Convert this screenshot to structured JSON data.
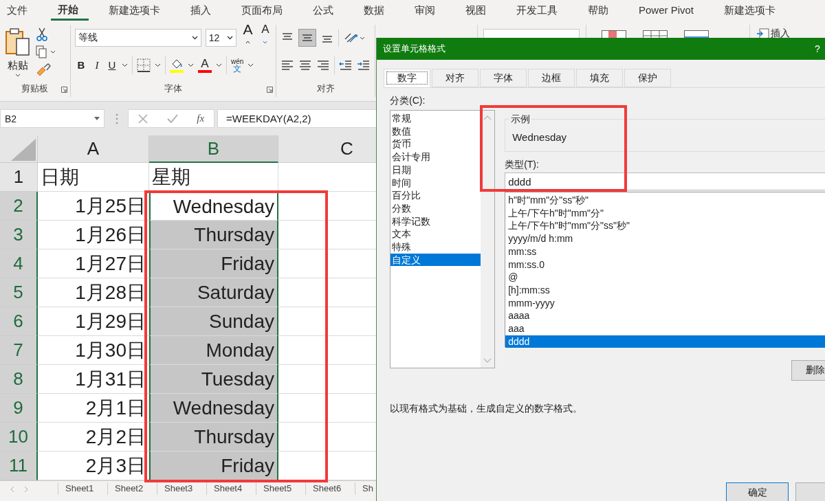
{
  "menu_tabs": [
    {
      "label": "文件",
      "selected": false
    },
    {
      "label": "开始",
      "selected": true
    },
    {
      "label": "新建选项卡",
      "selected": false
    },
    {
      "label": "插入",
      "selected": false
    },
    {
      "label": "页面布局",
      "selected": false
    },
    {
      "label": "公式",
      "selected": false
    },
    {
      "label": "数据",
      "selected": false
    },
    {
      "label": "审阅",
      "selected": false
    },
    {
      "label": "视图",
      "selected": false
    },
    {
      "label": "开发工具",
      "selected": false
    },
    {
      "label": "帮助",
      "selected": false
    },
    {
      "label": "Power Pivot",
      "selected": false
    },
    {
      "label": "新建选项卡",
      "selected": false
    }
  ],
  "ribbon": {
    "paste_label": "粘贴",
    "clipboard_group": "剪贴板",
    "font_name": "等线",
    "font_size": "12",
    "grow_font": "A",
    "shrink_font": "A",
    "bold": "B",
    "italic": "I",
    "underline": "U",
    "font_color": "A",
    "phonetic_top": "wén",
    "phonetic_bottom": "文",
    "font_group": "字体",
    "alignment_group": "对齐",
    "insert_label": "插入"
  },
  "formula_bar": {
    "name_box": "B2",
    "function_label": "fx",
    "formula": "=WEEKDAY(A2,2)"
  },
  "sheet": {
    "columns": [
      {
        "label": "A",
        "selected": false
      },
      {
        "label": "B",
        "selected": true
      },
      {
        "label": "C",
        "selected": false
      }
    ],
    "rows": [
      {
        "number": "1",
        "selected": false,
        "cells": [
          {
            "text": "日期",
            "kind": "header",
            "active": false,
            "selected": false
          },
          {
            "text": "星期",
            "kind": "header",
            "active": false,
            "selected": false
          }
        ]
      },
      {
        "number": "2",
        "selected": true,
        "cells": [
          {
            "text": "1月25日",
            "kind": "data",
            "active": false,
            "selected": false
          },
          {
            "text": "Wednesday",
            "kind": "data",
            "active": true,
            "selected": true
          }
        ]
      },
      {
        "number": "3",
        "selected": true,
        "cells": [
          {
            "text": "1月26日",
            "kind": "data",
            "active": false,
            "selected": false
          },
          {
            "text": "Thursday",
            "kind": "data",
            "active": false,
            "selected": true
          }
        ]
      },
      {
        "number": "4",
        "selected": true,
        "cells": [
          {
            "text": "1月27日",
            "kind": "data",
            "active": false,
            "selected": false
          },
          {
            "text": "Friday",
            "kind": "data",
            "active": false,
            "selected": true
          }
        ]
      },
      {
        "number": "5",
        "selected": true,
        "cells": [
          {
            "text": "1月28日",
            "kind": "data",
            "active": false,
            "selected": false
          },
          {
            "text": "Saturday",
            "kind": "data",
            "active": false,
            "selected": true
          }
        ]
      },
      {
        "number": "6",
        "selected": true,
        "cells": [
          {
            "text": "1月29日",
            "kind": "data",
            "active": false,
            "selected": false
          },
          {
            "text": "Sunday",
            "kind": "data",
            "active": false,
            "selected": true
          }
        ]
      },
      {
        "number": "7",
        "selected": true,
        "cells": [
          {
            "text": "1月30日",
            "kind": "data",
            "active": false,
            "selected": false
          },
          {
            "text": "Monday",
            "kind": "data",
            "active": false,
            "selected": true
          }
        ]
      },
      {
        "number": "8",
        "selected": true,
        "cells": [
          {
            "text": "1月31日",
            "kind": "data",
            "active": false,
            "selected": false
          },
          {
            "text": "Tuesday",
            "kind": "data",
            "active": false,
            "selected": true
          }
        ]
      },
      {
        "number": "9",
        "selected": true,
        "cells": [
          {
            "text": "2月1日",
            "kind": "data",
            "active": false,
            "selected": false
          },
          {
            "text": "Wednesday",
            "kind": "data",
            "active": false,
            "selected": true
          }
        ]
      },
      {
        "number": "10",
        "selected": true,
        "cells": [
          {
            "text": "2月2日",
            "kind": "data",
            "active": false,
            "selected": false
          },
          {
            "text": "Thursday",
            "kind": "data",
            "active": false,
            "selected": true
          }
        ]
      },
      {
        "number": "11",
        "selected": true,
        "cells": [
          {
            "text": "2月3日",
            "kind": "data",
            "active": false,
            "selected": false
          },
          {
            "text": "Friday",
            "kind": "data",
            "active": false,
            "selected": true
          }
        ]
      }
    ]
  },
  "sheet_tabs": [
    "Sheet1",
    "Sheet2",
    "Sheet3",
    "Sheet4",
    "Sheet5",
    "Sheet6",
    "Sh"
  ],
  "dialog": {
    "title": "设置单元格格式",
    "help": "?",
    "tabs": [
      {
        "label": "数字",
        "selected": true
      },
      {
        "label": "对齐",
        "selected": false
      },
      {
        "label": "字体",
        "selected": false
      },
      {
        "label": "边框",
        "selected": false
      },
      {
        "label": "填充",
        "selected": false
      },
      {
        "label": "保护",
        "selected": false
      }
    ],
    "category_label": "分类(C):",
    "categories": [
      {
        "label": "常规",
        "selected": false
      },
      {
        "label": "数值",
        "selected": false
      },
      {
        "label": "货币",
        "selected": false
      },
      {
        "label": "会计专用",
        "selected": false
      },
      {
        "label": "日期",
        "selected": false
      },
      {
        "label": "时间",
        "selected": false
      },
      {
        "label": "百分比",
        "selected": false
      },
      {
        "label": "分数",
        "selected": false
      },
      {
        "label": "科学记数",
        "selected": false
      },
      {
        "label": "文本",
        "selected": false
      },
      {
        "label": "特殊",
        "selected": false
      },
      {
        "label": "自定义",
        "selected": true
      }
    ],
    "sample_label": "示例",
    "sample": "Wednesday",
    "type_label": "类型(T):",
    "type_value": "dddd",
    "types": [
      {
        "label": "h\"时\"mm\"分\"ss\"秒\"",
        "selected": false
      },
      {
        "label": "上午/下午h\"时\"mm\"分\"",
        "selected": false
      },
      {
        "label": "上午/下午h\"时\"mm\"分\"ss\"秒\"",
        "selected": false
      },
      {
        "label": "yyyy/m/d h:mm",
        "selected": false
      },
      {
        "label": "mm:ss",
        "selected": false
      },
      {
        "label": "mm:ss.0",
        "selected": false
      },
      {
        "label": "@",
        "selected": false
      },
      {
        "label": "[h]:mm:ss",
        "selected": false
      },
      {
        "label": "mmm-yyyy",
        "selected": false
      },
      {
        "label": "aaaa",
        "selected": false
      },
      {
        "label": "aaa",
        "selected": false
      },
      {
        "label": "dddd",
        "selected": true
      }
    ],
    "delete_button": "删除",
    "description": "以现有格式为基础，生成自定义的数字格式。",
    "ok_button": "确定"
  }
}
